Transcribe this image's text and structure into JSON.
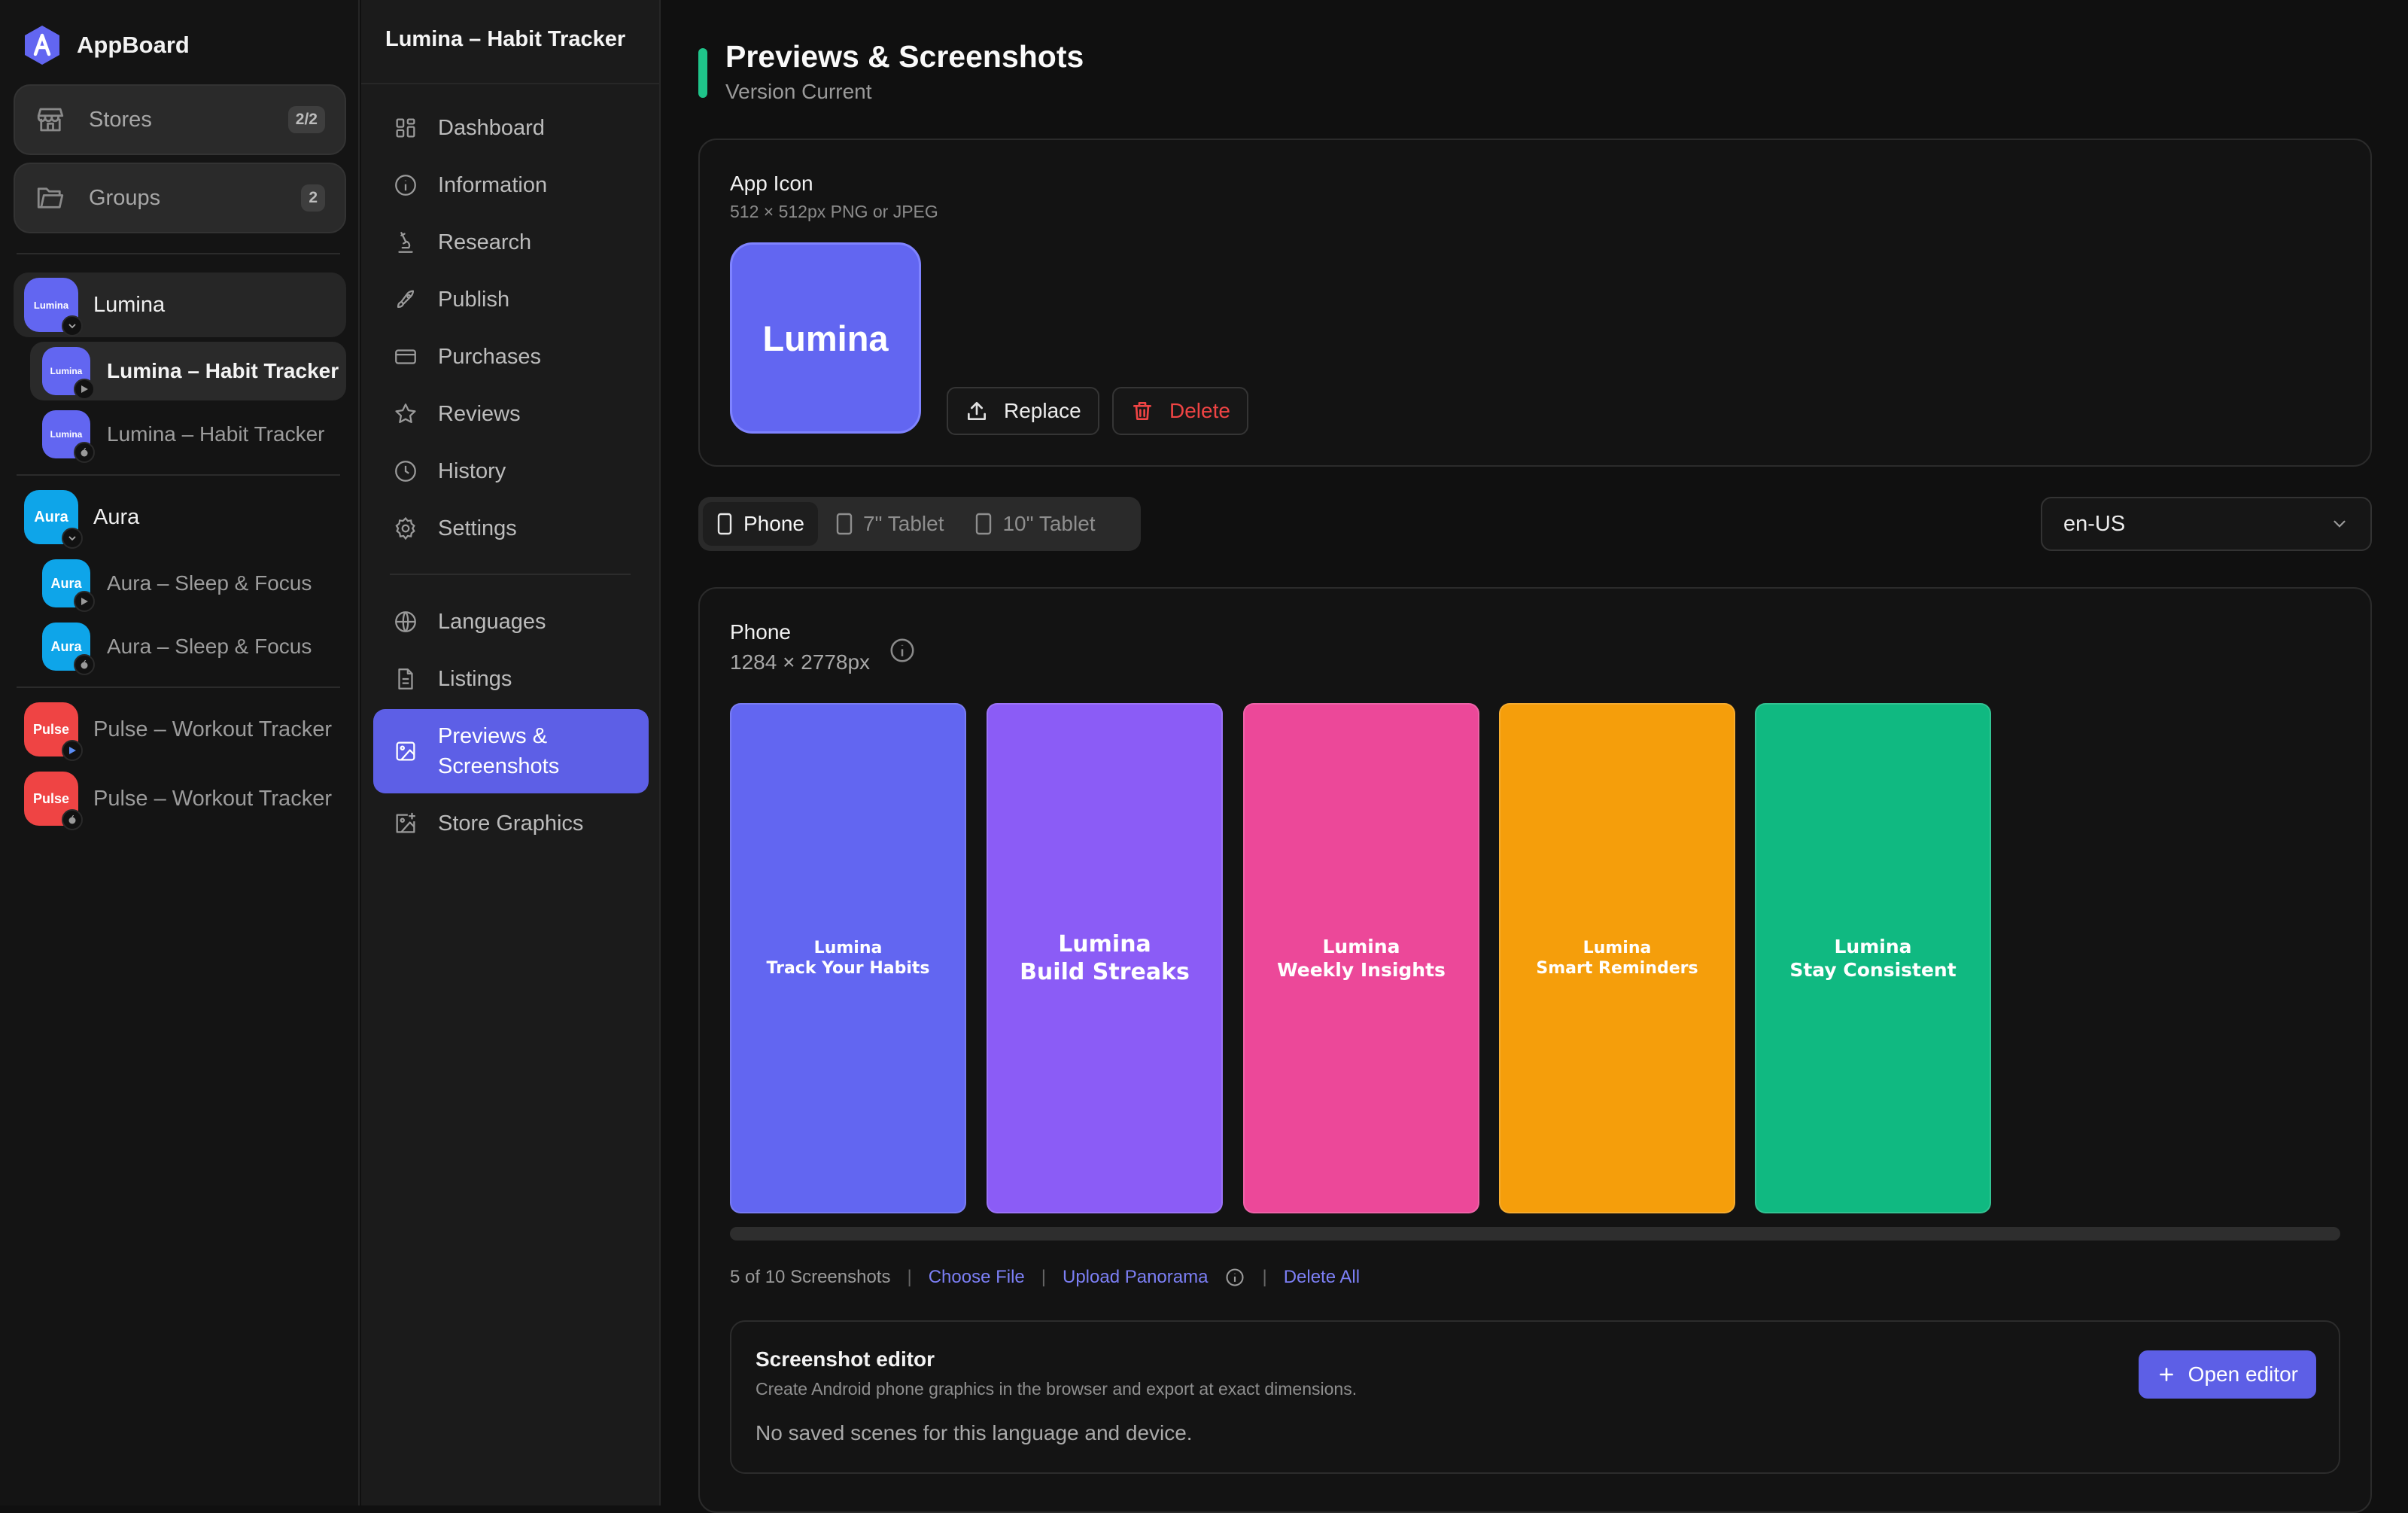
{
  "app": {
    "name": "AppBoard"
  },
  "sidebar": {
    "stores": {
      "label": "Stores",
      "badge": "2/2"
    },
    "groups": {
      "label": "Groups",
      "badge": "2"
    },
    "apps": [
      {
        "name": "Lumina",
        "avatar": "Lumina",
        "color": "#6266f1",
        "children": [
          {
            "name": "Lumina – Habit Tracker",
            "avatar": "Lumina",
            "platform": "google-play-icon"
          },
          {
            "name": "Lumina – Habit Tracker",
            "avatar": "Lumina",
            "platform": "apple-icon"
          }
        ]
      },
      {
        "name": "Aura",
        "avatar": "Aura",
        "color": "#0ea5e9",
        "children": [
          {
            "name": "Aura – Sleep & Focus",
            "avatar": "Aura",
            "platform": "google-play-icon"
          },
          {
            "name": "Aura – Sleep & Focus",
            "avatar": "Aura",
            "platform": "apple-icon"
          }
        ]
      },
      {
        "name": "Pulse – Workout Tracker",
        "avatar": "Pulse",
        "color": "#ef4444",
        "platform": "google-play-icon"
      },
      {
        "name": "Pulse – Workout Tracker",
        "avatar": "Pulse",
        "color": "#ef4444",
        "platform": "apple-icon"
      }
    ]
  },
  "menu": {
    "title": "Lumina – Habit Tracker",
    "items": [
      {
        "label": "Dashboard",
        "icon": "dashboard-icon"
      },
      {
        "label": "Information",
        "icon": "info-icon"
      },
      {
        "label": "Research",
        "icon": "microscope-icon"
      },
      {
        "label": "Publish",
        "icon": "rocket-icon"
      },
      {
        "label": "Purchases",
        "icon": "credit-card-icon"
      },
      {
        "label": "Reviews",
        "icon": "star-icon"
      },
      {
        "label": "History",
        "icon": "clock-icon"
      },
      {
        "label": "Settings",
        "icon": "gear-icon"
      },
      {
        "label": "Languages",
        "icon": "globe-icon"
      },
      {
        "label": "Listings",
        "icon": "document-icon"
      },
      {
        "label": "Previews & Screenshots",
        "label_line1": "Previews &",
        "label_line2": "Screenshots",
        "icon": "image-icon",
        "active": true
      },
      {
        "label": "Store Graphics",
        "icon": "image-plus-icon"
      }
    ]
  },
  "page": {
    "title": "Previews & Screenshots",
    "subtitle": "Version Current",
    "accent": "#1fc48a"
  },
  "app_icon": {
    "label": "App Icon",
    "hint": "512 × 512px PNG or JPEG",
    "icon_text": "Lumina",
    "replace_label": "Replace",
    "delete_label": "Delete"
  },
  "devices": {
    "tabs": [
      "Phone",
      "7\" Tablet",
      "10\" Tablet"
    ],
    "selected": "Phone"
  },
  "locale": {
    "value": "en-US"
  },
  "phone_section": {
    "label": "Phone",
    "size": "1284 × 2778px",
    "screenshots": [
      {
        "line1": "Lumina",
        "line2": "Track Your Habits",
        "color": "#6266f1"
      },
      {
        "line1": "Lumina",
        "line2": "Build Streaks",
        "color": "#8b5cf6"
      },
      {
        "line1": "Lumina",
        "line2": "Weekly Insights",
        "color": "#ec4899"
      },
      {
        "line1": "Lumina",
        "line2": "Smart Reminders",
        "color": "#f59e0b"
      },
      {
        "line1": "Lumina",
        "line2": "Stay Consistent",
        "color": "#10b981"
      }
    ],
    "count_text": "5 of 10 Screenshots",
    "choose_file": "Choose File",
    "upload_panorama": "Upload Panorama",
    "delete_all": "Delete All"
  },
  "editor": {
    "title": "Screenshot editor",
    "subtitle": "Create Android phone graphics in the browser and export at exact dimensions.",
    "empty": "No saved scenes for this language and device.",
    "open_label": "Open editor"
  }
}
